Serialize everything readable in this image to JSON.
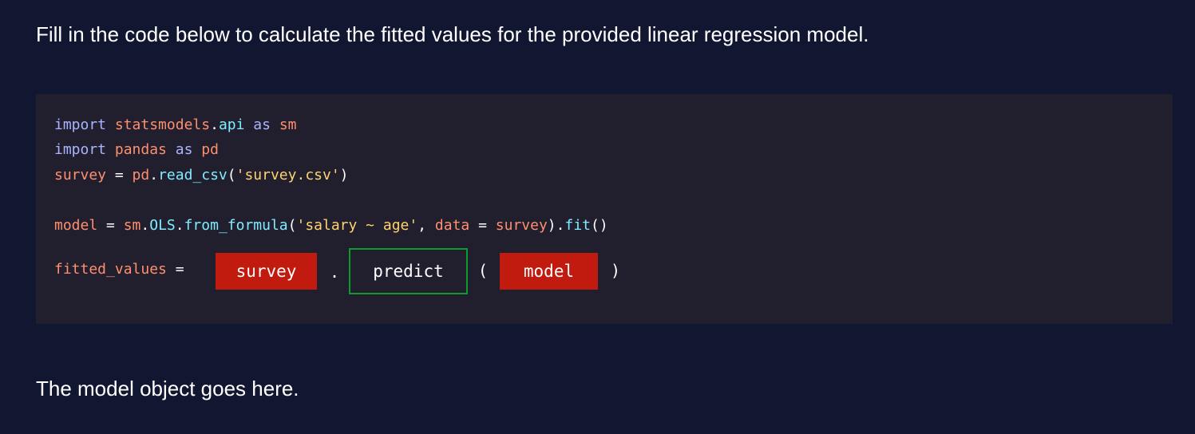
{
  "instruction": "Fill in the code below to calculate the fitted values for the provided linear regression model.",
  "code": {
    "line1": {
      "kw1": "import",
      "mod": "statsmodels",
      "dot": ".",
      "sub": "api",
      "kw2": "as",
      "alias": "sm"
    },
    "line2": {
      "kw1": "import",
      "mod": "pandas",
      "kw2": "as",
      "alias": "pd"
    },
    "line3": {
      "var": "survey",
      "eq": " = ",
      "obj": "pd",
      "dot": ".",
      "fn": "read_csv",
      "open": "(",
      "arg": "'survey.csv'",
      "close": ")"
    },
    "line4": {
      "var": "model",
      "eq": " = ",
      "obj": "sm",
      "dot1": ".",
      "cls": "OLS",
      "dot2": ".",
      "fn": "from_formula",
      "open": "(",
      "arg": "'salary ~ age'",
      "comma": ", ",
      "kwarg": "data",
      "eq2": " = ",
      "val": "survey",
      "close": ")",
      "dot3": ".",
      "fit": "fit",
      "parens": "()"
    },
    "line5": {
      "var": "fitted_values",
      "eq": " ="
    }
  },
  "blanks": {
    "first": "survey",
    "dot": ".",
    "second": "predict",
    "open": "(",
    "third": "model",
    "close": ")"
  },
  "feedback": "The model object goes here.",
  "colors": {
    "background": "#111631",
    "code_background": "#211f2e",
    "incorrect": "#c01b0e",
    "correct": "#0d9b2d"
  }
}
